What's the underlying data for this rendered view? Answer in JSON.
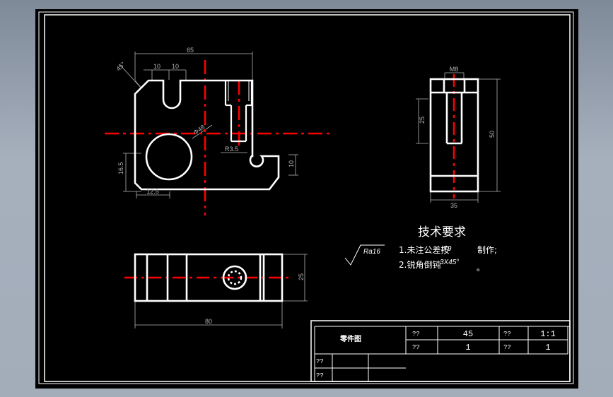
{
  "colors": {
    "background": "#000000",
    "outline": "#ffffff",
    "centerline": "#ff0000",
    "dimension": "#b4b4b4",
    "frame": "#ffffff"
  },
  "dimensions": {
    "front_width": "65",
    "front_angle": "45°",
    "front_slot_a": "10",
    "front_slot_b": "10",
    "front_circle": "Φ48",
    "front_height_left": "16.5",
    "front_bottom": "12.5",
    "front_radius": "R3.5",
    "front_notch": "10",
    "side_top": "M8",
    "side_slot_height": "25",
    "side_height": "50",
    "side_width": "35",
    "top_width": "80",
    "top_height": "25"
  },
  "notes": {
    "title": "技术要求",
    "roughness": "Ra16",
    "item1_prefix": "1.未注公差按",
    "item1_std": "IT9",
    "item1_suffix": "制作;",
    "item2_prefix": "2.锐角倒钝",
    "item2_std": "3X45°",
    "item2_suffix": "。"
  },
  "title_block": {
    "part_name": "零件图",
    "label_material": "??",
    "material_value": "45",
    "label_scale": "??",
    "scale_value": "1:1",
    "label_qty": "??",
    "qty_value": "1",
    "label_sheet": "??",
    "sheet_value": "1",
    "label_designer": "??",
    "label_checker": "??"
  }
}
